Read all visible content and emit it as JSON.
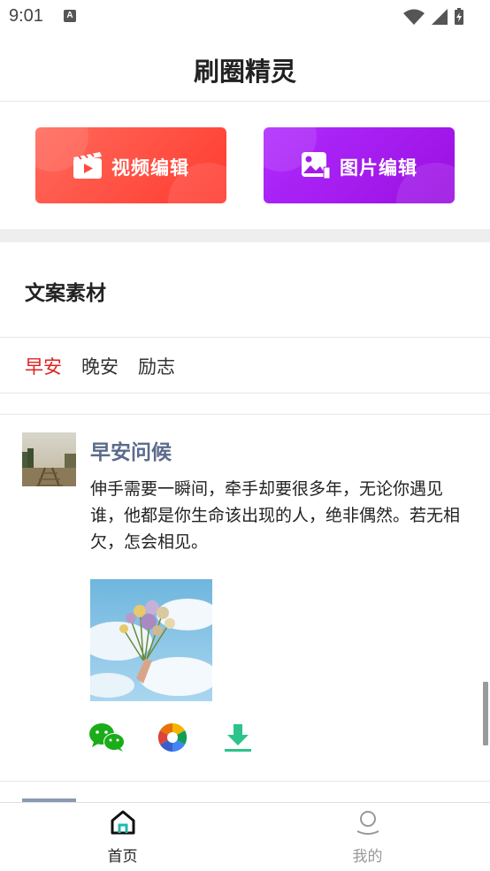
{
  "status_bar": {
    "time": "9:01",
    "notification_icon": "A"
  },
  "header": {
    "title": "刷圈精灵"
  },
  "edit_buttons": [
    {
      "label": "视频编辑",
      "icon": "video-icon",
      "color": "#ff4b3e"
    },
    {
      "label": "图片编辑",
      "icon": "image-icon",
      "color": "#a31be8"
    }
  ],
  "section": {
    "title": "文案素材"
  },
  "tabs": [
    {
      "label": "早安",
      "active": true
    },
    {
      "label": "晚安",
      "active": false
    },
    {
      "label": "励志",
      "active": false
    }
  ],
  "post": {
    "title": "早安问候",
    "text": "伸手需要一瞬间，牵手却要很多年，无论你遇见谁，他都是你生命该出现的人，绝非偶然。若无相欠，怎会相见。",
    "actions": [
      "wechat-icon",
      "moments-icon",
      "download-icon"
    ]
  },
  "bottom_nav": [
    {
      "label": "首页",
      "icon": "home-icon",
      "active": true
    },
    {
      "label": "我的",
      "icon": "profile-icon",
      "active": false
    }
  ],
  "colors": {
    "accent_red": "#e02020",
    "title_blue": "#5a6b8c",
    "download_green": "#2bc48a",
    "wechat_green": "#1aad19"
  }
}
